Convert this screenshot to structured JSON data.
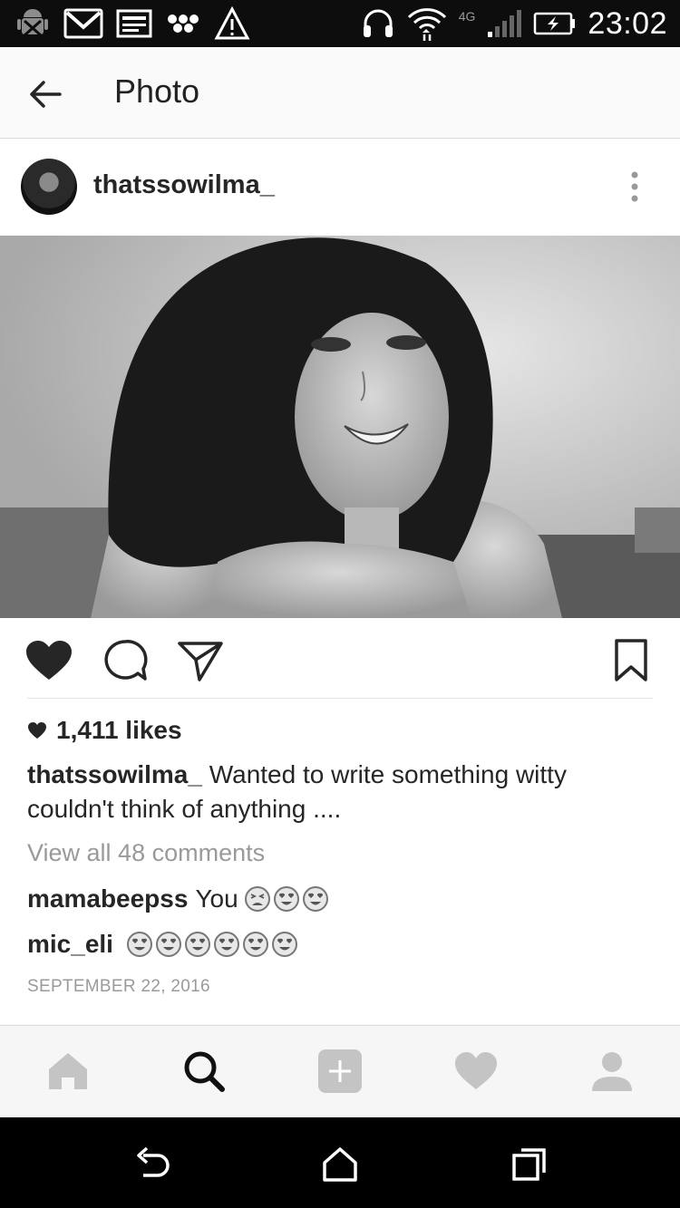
{
  "status_bar": {
    "time": "23:02",
    "network": "4G",
    "icons": [
      "android-debug-icon",
      "gmail-icon",
      "image-icon",
      "dots-icon",
      "warning-icon",
      "headphones-icon",
      "wifi-icon",
      "signal-icon",
      "battery-charging-icon"
    ]
  },
  "header": {
    "title": "Photo",
    "back_icon": "arrow-left-icon"
  },
  "post": {
    "username": "thatssowilma_",
    "more_icon": "more-vertical-icon",
    "likes": "1,411 likes",
    "caption_user": "thatssowilma_",
    "caption_text": "Wanted to write something witty couldn't think of anything ....",
    "view_all": "View all 48 comments",
    "comments": [
      {
        "user": "mamabeepss",
        "text": "You",
        "emojis": [
          "tired-face-emoji",
          "heart-eyes-emoji",
          "heart-eyes-emoji"
        ]
      },
      {
        "user": "mic_eli",
        "text": "",
        "emojis": [
          "heart-eyes-emoji",
          "heart-eyes-emoji",
          "heart-eyes-emoji",
          "heart-eyes-emoji",
          "heart-eyes-emoji",
          "heart-eyes-emoji"
        ]
      }
    ],
    "date": "SEPTEMBER 22, 2016"
  },
  "actions": [
    "like-icon",
    "comment-icon",
    "share-icon",
    "bookmark-icon"
  ],
  "bottom_nav": [
    "home-icon",
    "search-icon",
    "add-icon",
    "activity-icon",
    "profile-icon"
  ],
  "system_nav": [
    "back-icon",
    "home-icon",
    "recents-icon"
  ]
}
